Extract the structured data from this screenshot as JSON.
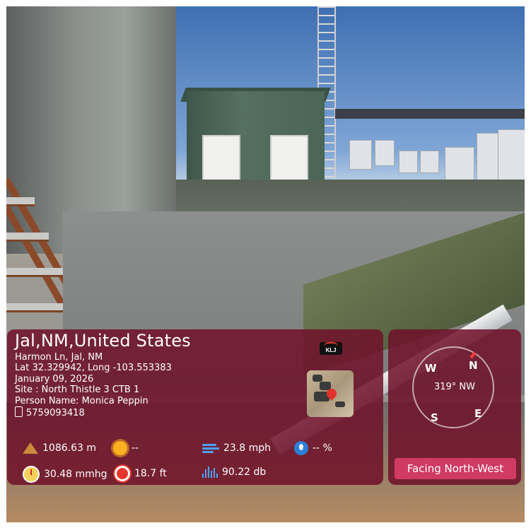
{
  "location": {
    "title": "Jal,NM,United States",
    "address": "Harmon Ln, Jal, NM",
    "coordinates": "Lat 32.329942, Long -103.553383",
    "date": "January 09, 2026",
    "site": "Site : North Thistle 3 CTB 1",
    "person": "Person Name: Monica Peppin",
    "phone": "5759093418"
  },
  "brand": {
    "logo_text": "KLJ"
  },
  "stats": {
    "altitude": "1086.63 m",
    "weather": "--",
    "wind": "23.8 mph",
    "humidity": "-- %",
    "pressure": "30.48 mmhg",
    "accuracy": "18.7 ft",
    "noise": "90.22 db"
  },
  "compass": {
    "heading": "319° NW",
    "labels": {
      "n": "N",
      "e": "E",
      "s": "S",
      "w": "W"
    },
    "facing_label": "Facing North-West"
  },
  "icons": {
    "altitude": "mountain-icon",
    "weather": "sun-icon",
    "wind": "wind-icon",
    "humidity": "water-drop-icon",
    "pressure": "gauge-icon",
    "accuracy": "target-icon",
    "noise": "sound-wave-icon",
    "phone": "phone-icon",
    "map_pin": "map-pin-icon"
  },
  "colors": {
    "overlay": "#70122a",
    "facing_button": "#d03a63",
    "needle": "#ff3b3b"
  }
}
